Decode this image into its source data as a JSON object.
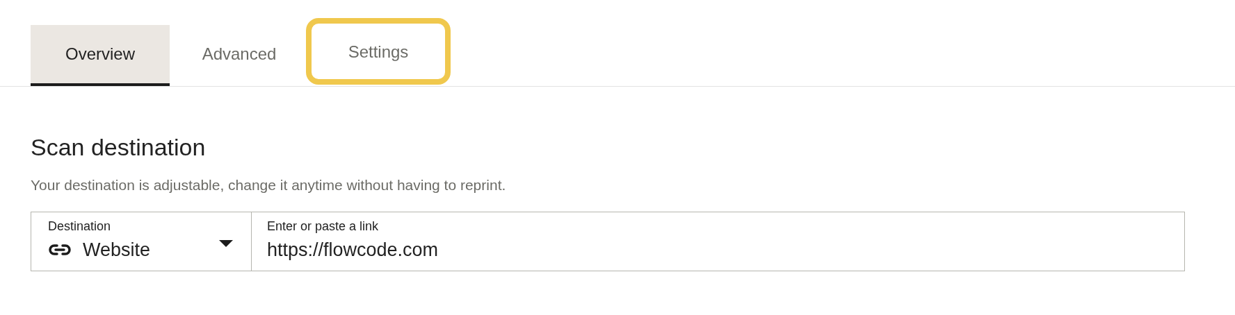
{
  "tabs": [
    {
      "label": "Overview",
      "selected": true,
      "focused": false
    },
    {
      "label": "Advanced",
      "selected": false,
      "focused": false
    },
    {
      "label": "Settings",
      "selected": false,
      "focused": true
    }
  ],
  "section": {
    "title": "Scan destination",
    "description": "Your destination is adjustable, change it anytime without having to reprint."
  },
  "destination": {
    "label": "Destination",
    "value": "Website"
  },
  "link": {
    "label": "Enter or paste a link",
    "value": "https://flowcode.com"
  }
}
